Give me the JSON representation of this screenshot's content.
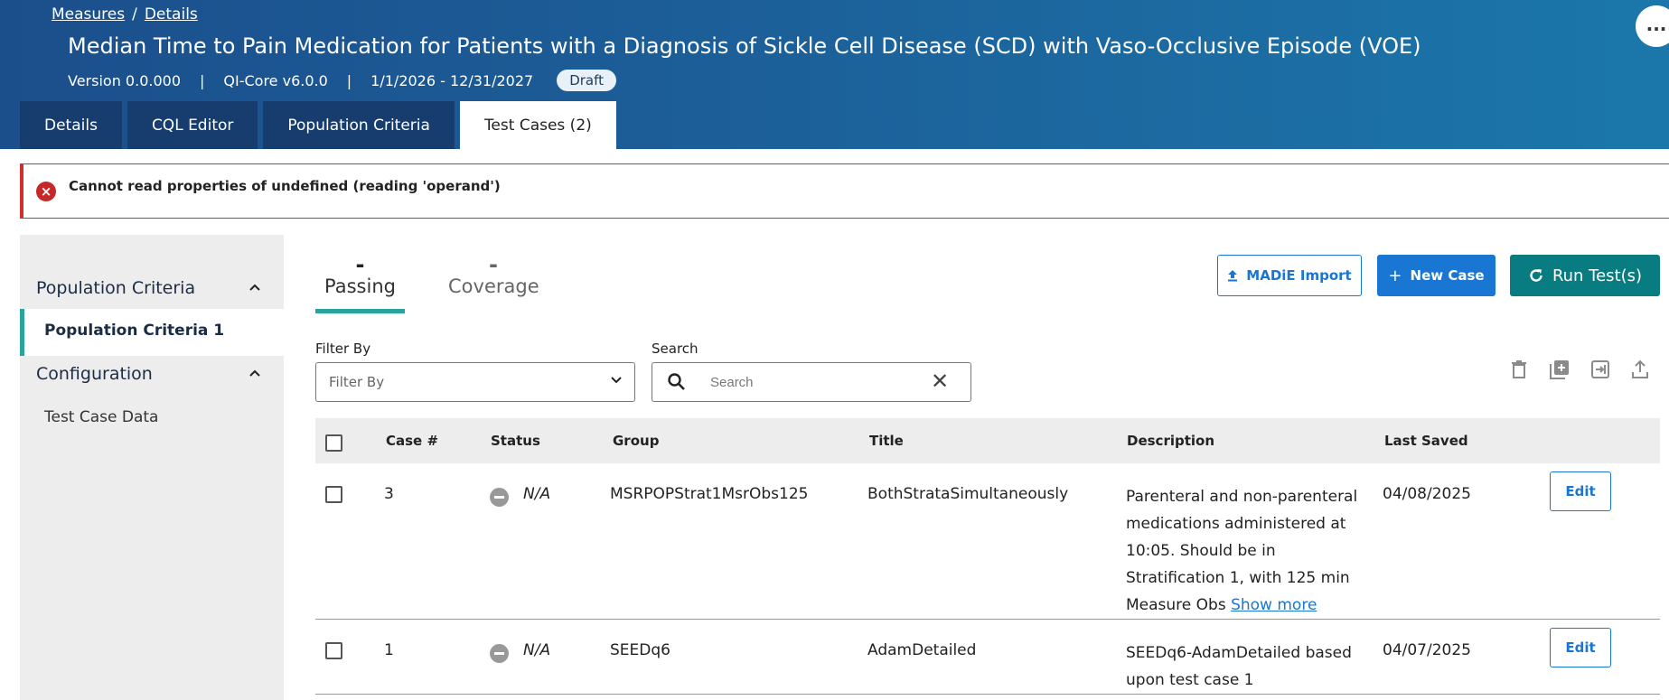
{
  "breadcrumb": {
    "items": [
      "Measures",
      "Details"
    ],
    "separator": "/"
  },
  "page": {
    "title": "Median Time to Pain Medication for Patients with a Diagnosis of Sickle Cell Disease (SCD) with Vaso-Occlusive Episode (VOE)",
    "version": "Version 0.0.000",
    "model": "QI-Core v6.0.0",
    "period": "1/1/2026 - 12/31/2027",
    "status_badge": "Draft",
    "more_label": "..."
  },
  "tabs": [
    {
      "label": "Details",
      "active": false
    },
    {
      "label": "CQL Editor",
      "active": false
    },
    {
      "label": "Population Criteria",
      "active": false
    },
    {
      "label": "Test Cases (2)",
      "active": true
    }
  ],
  "error": {
    "message": "Cannot read properties of undefined (reading 'operand')",
    "icon": "error-x-icon"
  },
  "sidebar": {
    "section1": {
      "label": "Population Criteria",
      "icon": "chevron-up-icon"
    },
    "section1_items": [
      "Population Criteria 1"
    ],
    "section2": {
      "label": "Configuration",
      "icon": "chevron-up-icon"
    },
    "section2_items": [
      "Test Case Data"
    ]
  },
  "stats": {
    "passing": {
      "value": "-",
      "label": "Passing"
    },
    "coverage": {
      "value": "-",
      "label": "Coverage"
    }
  },
  "actions": {
    "import_label": "MADiE Import",
    "new_case_label": "New Case",
    "run_tests_label": "Run Test(s)"
  },
  "filter": {
    "label": "Filter By",
    "placeholder": "Filter By"
  },
  "search": {
    "label": "Search",
    "placeholder": "Search"
  },
  "toolbar_icons": [
    "delete-icon",
    "add-box-icon",
    "export-icon",
    "upload-icon"
  ],
  "table": {
    "headers": [
      "Case #",
      "Status",
      "Group",
      "Title",
      "Description",
      "Last Saved"
    ],
    "rows": [
      {
        "case": "3",
        "status": "N/A",
        "group": "MSRPOPStrat1MsrObs125",
        "title": "BothStrataSimultaneously",
        "description": "Parenteral and non-parenteral medications administered at 10:05. Should be in Stratification 1, with 125 min Measure Obs",
        "show_more": "Show more",
        "last_saved": "04/08/2025",
        "edit_label": "Edit"
      },
      {
        "case": "1",
        "status": "N/A",
        "group": "SEEDq6",
        "title": "AdamDetailed",
        "description": "SEEDq6-AdamDetailed based upon test case 1",
        "last_saved": "04/07/2025",
        "edit_label": "Edit"
      }
    ]
  },
  "colors": {
    "header_start": "#1b4f8c",
    "header_end": "#1b77aa",
    "primary": "#1976d2",
    "teal": "#087c80",
    "accent": "#2aa39b",
    "error": "#d32f2f"
  }
}
